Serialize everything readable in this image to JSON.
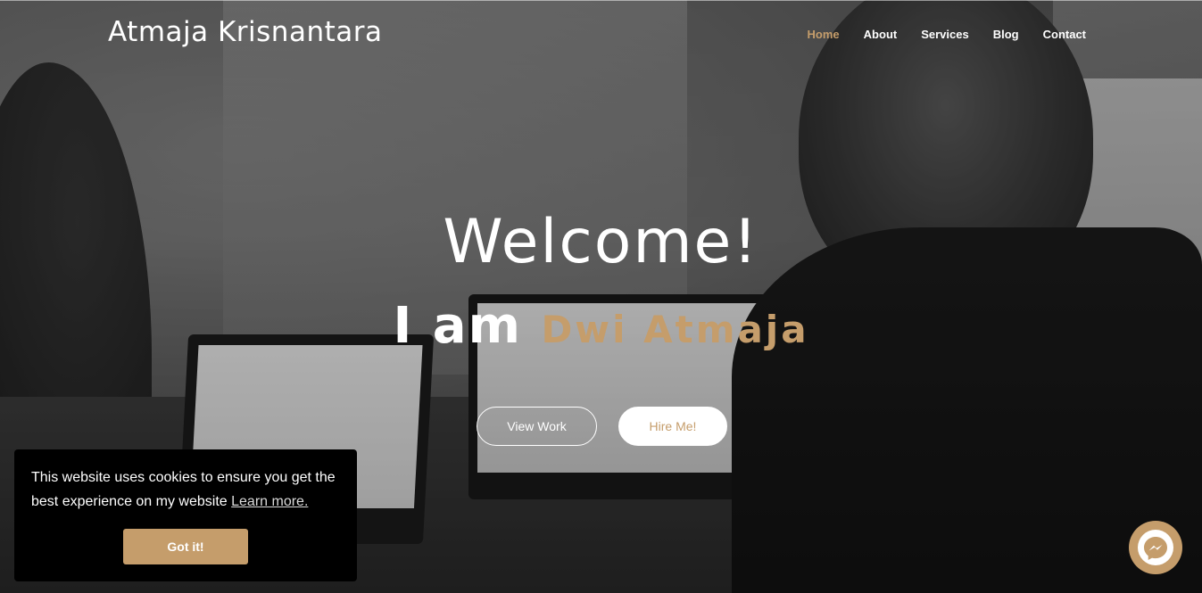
{
  "header": {
    "brand": "Atmaja Krisnantara",
    "nav": [
      {
        "label": "Home",
        "active": true
      },
      {
        "label": "About",
        "active": false
      },
      {
        "label": "Services",
        "active": false
      },
      {
        "label": "Blog",
        "active": false
      },
      {
        "label": "Contact",
        "active": false
      }
    ]
  },
  "hero": {
    "welcome": "Welcome!",
    "lead": "I am",
    "name": "Dwi Atmaja",
    "buttons": {
      "view_work": "View Work",
      "hire_me": "Hire Me!"
    }
  },
  "cookie": {
    "text": "This website uses cookies to ensure you get the best experience on my website",
    "link": "Learn more.",
    "accept": "Got it!"
  },
  "messenger": {
    "icon": "messenger-icon"
  },
  "colors": {
    "accent": "#c59d6b",
    "cookie_bg": "#000000",
    "text_light": "#ffffff"
  }
}
